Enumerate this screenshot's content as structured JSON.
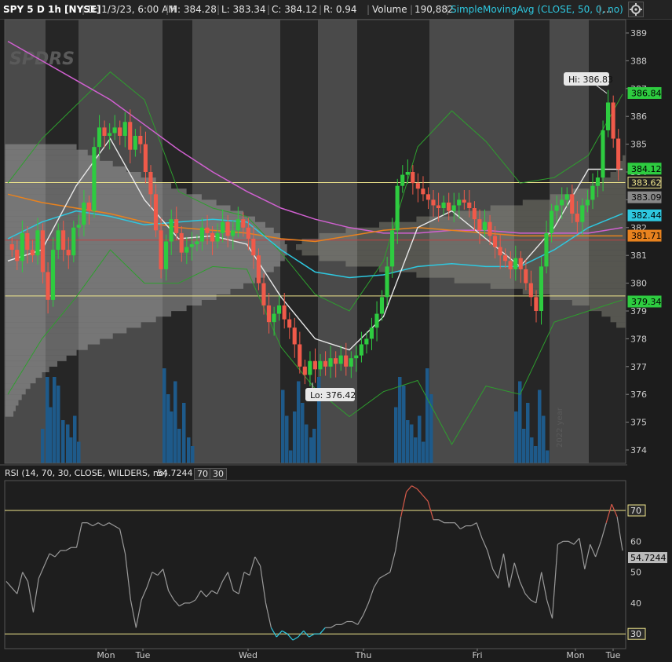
{
  "header": {
    "symbol": "SPY 5 D 1h [NYSE]",
    "date": "D: 1/3/23, 6:00 AM",
    "high": "H: 384.28",
    "low": "L: 383.34",
    "close": "C: 384.12",
    "range": "R: 0.94",
    "volume_label": "Volume",
    "volume_value": "190,882",
    "study": "SimpleMovingAvg (CLOSE, 50, 0, no)",
    "more": "..."
  },
  "watermark": "SPDRS",
  "vertical_note": "2022 year",
  "colors": {
    "up": "#2ecc40",
    "down": "#f05a4a",
    "sma_white": "#e8e8e8",
    "sma_cyan": "#2ec8e0",
    "sma_orange": "#e8821e",
    "sma_magenta": "#d060d0",
    "band_green": "#2e9e2e",
    "volume": "#1e5a8a",
    "yellow_line": "#f0e68c",
    "rsi_line": "#9a9a9a"
  },
  "chart_data": [
    {
      "type": "candlestick",
      "y_ticks": [
        389,
        388,
        387,
        386,
        385,
        384,
        383,
        382,
        381,
        380,
        379,
        378,
        377,
        376,
        375,
        374
      ],
      "ylim": [
        373.5,
        389.5
      ],
      "x_labels": [
        "Mon",
        "Tue",
        "Wed",
        "Thu",
        "Fri",
        "Mon",
        "Tue"
      ],
      "hi_label": "Hi: 386.83",
      "lo_label": "Lo: 376.42",
      "hi": 386.83,
      "lo": 376.42,
      "price_labels": [
        {
          "value": "386.84",
          "price": 386.84,
          "color": "#2ecc40",
          "text": "#000"
        },
        {
          "value": "384.12",
          "price": 384.12,
          "color": "#2ecc40",
          "text": "#000"
        },
        {
          "value": "383.62",
          "price": 383.62,
          "color": "#222",
          "text": "#f0e68c",
          "border": "#f0e68c"
        },
        {
          "value": "383.09",
          "price": 383.09,
          "color": "#888",
          "text": "#000"
        },
        {
          "value": "382.44",
          "price": 382.44,
          "color": "#2ec8e0",
          "text": "#000"
        },
        {
          "value": "381.71",
          "price": 381.71,
          "color": "#e8821e",
          "text": "#000"
        },
        {
          "value": "379.34",
          "price": 379.34,
          "color": "#2ecc40",
          "text": "#000"
        }
      ],
      "horizontal_lines": [
        383.62,
        379.54
      ],
      "red_line": 381.55,
      "session_closes": [
        381.3,
        385.7,
        381.6,
        377.2,
        384.1,
        380.3,
        383.8
      ],
      "candle_closes": [
        381.2,
        380.8,
        381.8,
        381.2,
        381.0,
        381.9,
        380.4,
        379.4,
        381.2,
        381.9,
        381.2,
        381.0,
        382.0,
        382.1,
        382.9,
        382.6,
        384.9,
        385.6,
        385.3,
        385.4,
        385.6,
        385.3,
        385.8,
        384.8,
        385.3,
        385.0,
        384.0,
        383.2,
        381.9,
        380.5,
        381.5,
        382.3,
        381.8,
        381.1,
        381.3,
        381.4,
        381.5,
        382.0,
        381.8,
        381.5,
        381.8,
        382.2,
        381.7,
        381.9,
        382.3,
        382.0,
        381.6,
        381.0,
        380.0,
        379.2,
        378.6,
        378.9,
        379.2,
        378.7,
        378.4,
        377.8,
        377.0,
        376.7,
        377.2,
        376.9,
        377.2,
        377.0,
        377.3,
        377.1,
        377.4,
        377.0,
        377.3,
        377.4,
        377.8,
        378.0,
        378.4,
        378.9,
        379.5,
        380.6,
        381.9,
        383.5,
        383.9,
        384.0,
        383.6,
        383.4,
        383.2,
        383.0,
        382.8,
        382.7,
        382.9,
        382.6,
        382.8,
        383.0,
        382.9,
        382.7,
        382.3,
        381.9,
        382.2,
        381.7,
        381.3,
        381.0,
        380.8,
        380.5,
        380.9,
        380.5,
        380.0,
        379.5,
        379.0,
        380.6,
        381.8,
        382.6,
        382.8,
        383.0,
        383.2,
        382.5,
        382.2,
        382.8,
        383.0,
        383.5,
        383.8,
        385.5,
        386.5,
        385.2,
        384.1
      ],
      "volume": [
        0.4,
        1.0,
        0.65,
        1.0,
        0.9,
        0.5,
        0.45,
        0.3,
        0.55,
        0.25,
        1.1,
        0.8,
        0.6,
        0.95,
        0.4,
        0.7,
        0.3,
        0.2,
        0.85,
        0.55,
        0.15,
        0.6,
        0.95,
        0.7,
        0.45,
        0.3
      ],
      "sma_white": [
        380.8,
        381.2,
        383.5,
        385.2,
        383.0,
        381.6,
        381.7,
        381.4,
        379.5,
        378.0,
        377.6,
        378.8,
        382.0,
        382.6,
        381.6,
        380.6,
        382.0,
        384.1,
        384.1
      ],
      "sma_cyan": [
        381.6,
        382.2,
        382.6,
        382.4,
        382.1,
        382.2,
        382.3,
        382.2,
        381.2,
        380.4,
        380.2,
        380.3,
        380.6,
        380.7,
        380.6,
        380.6,
        381.2,
        382.0,
        382.5
      ],
      "sma_orange": [
        383.2,
        382.9,
        382.7,
        382.5,
        382.2,
        382.0,
        381.9,
        381.8,
        381.6,
        381.5,
        381.7,
        381.9,
        382.0,
        381.9,
        381.8,
        381.7,
        381.7,
        381.7,
        381.7
      ],
      "sma_magenta": [
        388.7,
        388.0,
        387.3,
        386.6,
        385.7,
        384.8,
        384.0,
        383.3,
        382.7,
        382.3,
        382.0,
        381.8,
        381.8,
        381.9,
        381.9,
        381.8,
        381.8,
        381.8,
        382.0
      ],
      "band_upper": [
        383.6,
        385.2,
        386.4,
        387.6,
        386.6,
        383.3,
        382.7,
        382.4,
        381.1,
        379.6,
        379.0,
        380.8,
        384.9,
        386.2,
        385.1,
        383.6,
        383.8,
        384.6,
        386.8
      ],
      "band_lower": [
        376.0,
        378.0,
        379.5,
        381.2,
        380.0,
        380.0,
        380.6,
        380.5,
        377.7,
        376.2,
        375.2,
        376.1,
        376.5,
        374.2,
        376.3,
        376.0,
        378.6,
        379.0,
        379.4
      ]
    },
    {
      "type": "line",
      "title": "RSI (14, 70, 30, CLOSE, WILDERS, no)",
      "value": "54.7244",
      "overbought": "70",
      "oversold": "30",
      "y_ticks": [
        "70",
        "60",
        "50",
        "40",
        "30"
      ],
      "ylim": [
        23,
        81
      ],
      "values": [
        47,
        45,
        43,
        50,
        47,
        37,
        48,
        52,
        56,
        55,
        57,
        57,
        58,
        58,
        66,
        66,
        65,
        66,
        65,
        66,
        65,
        64,
        56,
        41,
        32,
        41,
        45,
        50,
        49,
        51,
        44,
        41,
        39,
        40,
        40,
        41,
        44,
        42,
        44,
        43,
        47,
        50,
        44,
        43,
        50,
        49,
        55,
        52,
        40,
        32,
        29,
        31,
        30,
        28,
        29,
        31,
        29,
        30,
        30,
        32,
        32,
        33,
        33,
        34,
        34,
        33,
        36,
        40,
        45,
        48,
        49,
        50,
        57,
        68,
        76,
        78,
        77,
        75,
        73,
        67,
        67,
        66,
        66,
        66,
        64,
        65,
        65,
        66,
        61,
        57,
        51,
        48,
        56,
        45,
        53,
        47,
        43,
        41,
        40,
        50,
        41,
        35,
        59,
        60,
        60,
        59,
        61,
        51,
        59,
        55,
        60,
        66,
        72,
        68,
        57
      ]
    }
  ]
}
